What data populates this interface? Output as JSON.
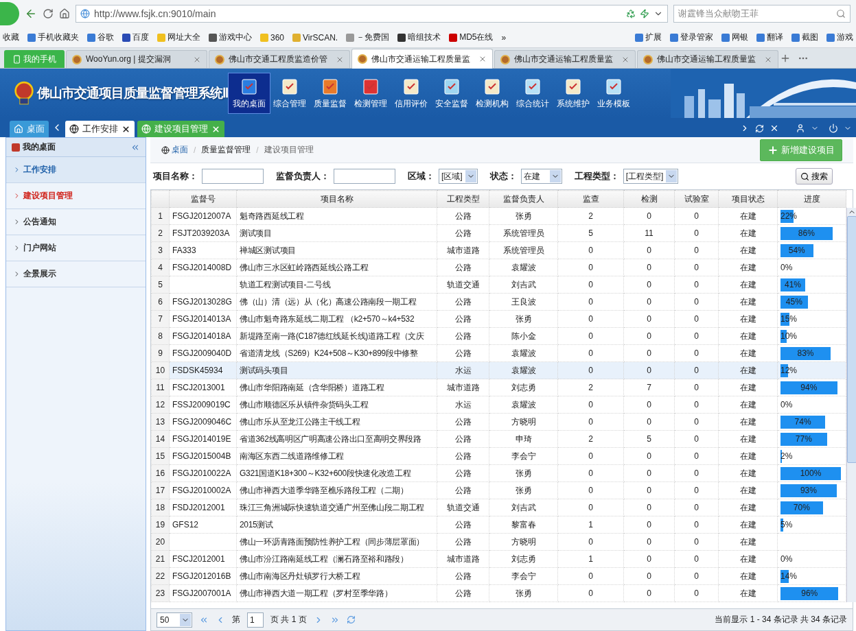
{
  "browser": {
    "url": "http://www.fsjk.cn:9010/main",
    "search": "谢霆锋当众献吻王菲",
    "bookmarks": [
      {
        "label": "收藏"
      },
      {
        "label": "手机收藏夹"
      },
      {
        "label": "谷歌"
      },
      {
        "label": "百度"
      },
      {
        "label": "网址大全"
      },
      {
        "label": "游戏中心"
      },
      {
        "label": "360"
      },
      {
        "label": "VirSCAN."
      },
      {
        "label": "－免费国"
      },
      {
        "label": "暗组技术"
      },
      {
        "label": "MD5在线"
      },
      {
        "label": "»"
      }
    ],
    "tools": [
      {
        "label": "扩展"
      },
      {
        "label": "登录管家"
      },
      {
        "label": "网银"
      },
      {
        "label": "翻译"
      },
      {
        "label": "截图"
      },
      {
        "label": "游戏"
      }
    ],
    "phone": "我的手机",
    "tabs": [
      {
        "label": "WooYun.org | 提交漏洞",
        "selected": false
      },
      {
        "label": "佛山市交通工程质监造价管",
        "selected": false
      },
      {
        "label": "佛山市交通运输工程质量监",
        "selected": true
      },
      {
        "label": "佛山市交通运输工程质量监",
        "selected": false
      },
      {
        "label": "佛山市交通运输工程质量监",
        "selected": false
      }
    ]
  },
  "app": {
    "title": "佛山市交通项目质量监督管理系统Ⅱ",
    "nav": [
      {
        "label": "我的桌面",
        "selected": true
      },
      {
        "label": "综合管理",
        "selected": false
      },
      {
        "label": "质量监督",
        "selected": false
      },
      {
        "label": "检测管理",
        "selected": false
      },
      {
        "label": "信用评价",
        "selected": false
      },
      {
        "label": "安全监督",
        "selected": false
      },
      {
        "label": "检测机构",
        "selected": false
      },
      {
        "label": "综合统计",
        "selected": false
      },
      {
        "label": "系统维护",
        "selected": false
      },
      {
        "label": "业务模板",
        "selected": false
      }
    ],
    "tabs": [
      {
        "label": "桌面",
        "kind": "home",
        "selected": false
      },
      {
        "label": "工作安排",
        "kind": "page",
        "selected": false
      },
      {
        "label": "建设项目管理",
        "kind": "page",
        "selected": true
      }
    ]
  },
  "sidebar": {
    "title": "我的桌面",
    "items": [
      {
        "label": "工作安排",
        "selected": false,
        "hovered": true
      },
      {
        "label": "建设项目管理",
        "selected": true,
        "hovered": false
      },
      {
        "label": "公告通知",
        "selected": false,
        "hovered": false
      },
      {
        "label": "门户网站",
        "selected": false,
        "hovered": false
      },
      {
        "label": "全景展示",
        "selected": false,
        "hovered": false
      }
    ]
  },
  "breadcrumb": [
    "桌面",
    "质量监督管理",
    "建设项目管理"
  ],
  "breadcrumb_separator": "/",
  "add_button": "新增建设项目",
  "filters": {
    "name_label": "项目名称：",
    "manager_label": "监督负责人：",
    "area_label": "区域：",
    "area_value": "[区域]",
    "status_label": "状态：",
    "status_value": "在建",
    "type_label": "工程类型：",
    "type_value": "[工程类型]",
    "search_button": "搜索"
  },
  "table": {
    "columns": [
      "监督号",
      "项目名称",
      "工程类型",
      "监督负责人",
      "监查",
      "检测",
      "试验室",
      "项目状态",
      "进度"
    ],
    "rows": [
      {
        "no": "1",
        "code": "FSGJ2012007A",
        "name": "魁奇路西延线工程",
        "type": "公路",
        "manager": "张勇",
        "supervise": "2",
        "test": "0",
        "lab": "0",
        "status": "在建",
        "progress": {
          "level": 0.22,
          "text": "22%"
        },
        "selected": false
      },
      {
        "no": "2",
        "code": "FSJT2039203A",
        "name": "测试项目",
        "type": "公路",
        "manager": "系统管理员",
        "supervise": "5",
        "test": "11",
        "lab": "0",
        "status": "在建",
        "progress": {
          "level": 0.86,
          "text": "86%"
        },
        "selected": false
      },
      {
        "no": "3",
        "code": "FA333",
        "name": "禅城区测试项目",
        "type": "城市道路",
        "manager": "系统管理员",
        "supervise": "0",
        "test": "0",
        "lab": "0",
        "status": "在建",
        "progress": {
          "level": 0.54,
          "text": "54%"
        },
        "selected": false
      },
      {
        "no": "4",
        "code": "FSGJ2014008D",
        "name": "佛山市三水区虹岭路西延线公路工程",
        "type": "公路",
        "manager": "袁耀波",
        "supervise": "0",
        "test": "0",
        "lab": "0",
        "status": "在建",
        "progress": {
          "level": 0,
          "text": "0%"
        },
        "selected": false
      },
      {
        "no": "5",
        "name": "轨道工程测试项目-二号线",
        "type": "轨道交通",
        "manager": "刘吉武",
        "supervise": "0",
        "test": "0",
        "lab": "0",
        "status": "在建",
        "progress": {
          "level": 0.41,
          "text": "41%"
        },
        "selected": false
      },
      {
        "no": "6",
        "code": "FSGJ2013028G",
        "name": "佛（山）清（远）从（化）高速公路南段一期工程",
        "type": "公路",
        "manager": "王良波",
        "supervise": "0",
        "test": "0",
        "lab": "0",
        "status": "在建",
        "progress": {
          "level": 0.45,
          "text": "45%"
        },
        "selected": false
      },
      {
        "no": "7",
        "code": "FSGJ2014013A",
        "name": "佛山市魁奇路东延线二期工程 （k2+570～k4+532",
        "type": "公路",
        "manager": "张勇",
        "supervise": "0",
        "test": "0",
        "lab": "0",
        "status": "在建",
        "progress": {
          "level": 0.15,
          "text": "15%"
        },
        "selected": false
      },
      {
        "no": "8",
        "code": "FSGJ2014018A",
        "name": "新堤路至南一路(C187德红线延长线)道路工程（文庆",
        "type": "公路",
        "manager": "陈小金",
        "supervise": "0",
        "test": "0",
        "lab": "0",
        "status": "在建",
        "progress": {
          "level": 0.1,
          "text": "10%"
        },
        "selected": false
      },
      {
        "no": "9",
        "code": "FSGJ2009040D",
        "name": "省道清龙线（S269）K24+508～K30+899段中修整",
        "type": "公路",
        "manager": "袁耀波",
        "supervise": "0",
        "test": "0",
        "lab": "0",
        "status": "在建",
        "progress": {
          "level": 0.83,
          "text": "83%"
        },
        "selected": false
      },
      {
        "no": "10",
        "code": "FSDSK45934",
        "name": "测试码头项目",
        "type": "水运",
        "manager": "袁耀波",
        "supervise": "0",
        "test": "0",
        "lab": "0",
        "status": "在建",
        "progress": {
          "level": 0.12,
          "text": "12%"
        },
        "selected": true
      },
      {
        "no": "11",
        "code": "FSCJ2013001",
        "name": "佛山市华阳路南延（含华阳桥）道路工程",
        "type": "城市道路",
        "manager": "刘志勇",
        "supervise": "2",
        "test": "7",
        "lab": "0",
        "status": "在建",
        "progress": {
          "level": 0.94,
          "text": "94%"
        },
        "selected": false
      },
      {
        "no": "12",
        "code": "FSSJ2009019C",
        "name": "佛山市顺德区乐从镇件杂货码头工程",
        "type": "水运",
        "manager": "袁耀波",
        "supervise": "0",
        "test": "0",
        "lab": "0",
        "status": "在建",
        "progress": {
          "level": 0,
          "text": "0%"
        },
        "selected": false
      },
      {
        "no": "13",
        "code": "FSGJ2009046C",
        "name": "佛山市乐从至龙江公路主干线工程",
        "type": "公路",
        "manager": "方晓明",
        "supervise": "0",
        "test": "0",
        "lab": "0",
        "status": "在建",
        "progress": {
          "level": 0.74,
          "text": "74%"
        },
        "selected": false
      },
      {
        "no": "14",
        "code": "FSGJ2014019E",
        "name": "省道362线高明区广明高速公路出口至高明交界段路",
        "type": "公路",
        "manager": "申琦",
        "supervise": "2",
        "test": "5",
        "lab": "0",
        "status": "在建",
        "progress": {
          "level": 0.77,
          "text": "77%"
        },
        "selected": false
      },
      {
        "no": "15",
        "code": "FSGJ2015004B",
        "name": "南海区东西二线道路维修工程",
        "type": "公路",
        "manager": "李会宁",
        "supervise": "0",
        "test": "0",
        "lab": "0",
        "status": "在建",
        "progress": {
          "level": 0.02,
          "text": "2%"
        },
        "selected": false
      },
      {
        "no": "16",
        "code": "FSGJ2010022A",
        "name": "G321国道K18+300～K32+600段快速化改造工程",
        "type": "公路",
        "manager": "张勇",
        "supervise": "0",
        "test": "0",
        "lab": "0",
        "status": "在建",
        "progress": {
          "level": 1,
          "text": "100%"
        },
        "selected": false
      },
      {
        "no": "17",
        "code": "FSGJ2010002A",
        "name": "佛山市禅西大道季华路至樵乐路段工程（二期）",
        "type": "公路",
        "manager": "张勇",
        "supervise": "0",
        "test": "0",
        "lab": "0",
        "status": "在建",
        "progress": {
          "level": 0.93,
          "text": "93%"
        },
        "selected": false
      },
      {
        "no": "18",
        "code": "FSDJ2012001",
        "name": "珠江三角洲城际快速轨道交通广州至佛山段二期工程",
        "type": "轨道交通",
        "manager": "刘吉武",
        "supervise": "0",
        "test": "0",
        "lab": "0",
        "status": "在建",
        "progress": {
          "level": 0.7,
          "text": "70%"
        },
        "selected": false
      },
      {
        "no": "19",
        "code": "GFS12",
        "name": "2015测试",
        "type": "公路",
        "manager": "黎富春",
        "supervise": "1",
        "test": "0",
        "lab": "0",
        "status": "在建",
        "progress": {
          "level": 0.05,
          "text": "5%"
        },
        "selected": false
      },
      {
        "no": "20",
        "name": "佛山一环沥青路面预防性养护工程（同步薄层罩面）",
        "type": "公路",
        "manager": "方晓明",
        "supervise": "0",
        "test": "0",
        "lab": "0",
        "status": "在建",
        "selected": false
      },
      {
        "no": "21",
        "code": "FSCJ2012001",
        "name": "佛山市汾江路南延线工程（澜石路至裕和路段）",
        "type": "城市道路",
        "manager": "刘志勇",
        "supervise": "1",
        "test": "0",
        "lab": "0",
        "status": "在建",
        "progress": {
          "level": 0,
          "text": "0%"
        },
        "selected": false
      },
      {
        "no": "22",
        "code": "FSGJ2012016B",
        "name": "佛山市南海区丹灶镇罗行大桥工程",
        "type": "公路",
        "manager": "李会宁",
        "supervise": "0",
        "test": "0",
        "lab": "0",
        "status": "在建",
        "progress": {
          "level": 0.14,
          "text": "14%"
        },
        "selected": false
      },
      {
        "no": "23",
        "code": "FSGJ2007001A",
        "name": "佛山市禅西大道一期工程（罗村至季华路）",
        "type": "公路",
        "manager": "张勇",
        "supervise": "0",
        "test": "0",
        "lab": "0",
        "status": "在建",
        "progress": {
          "level": 0.96,
          "text": "96%"
        },
        "selected": false
      }
    ]
  },
  "pager": {
    "page_size": "50",
    "page_prefix": "第",
    "page": "1",
    "page_suffix": "页 共 1 页",
    "summary": "当前显示 1 - 34 条记录 共 34 条记录"
  }
}
